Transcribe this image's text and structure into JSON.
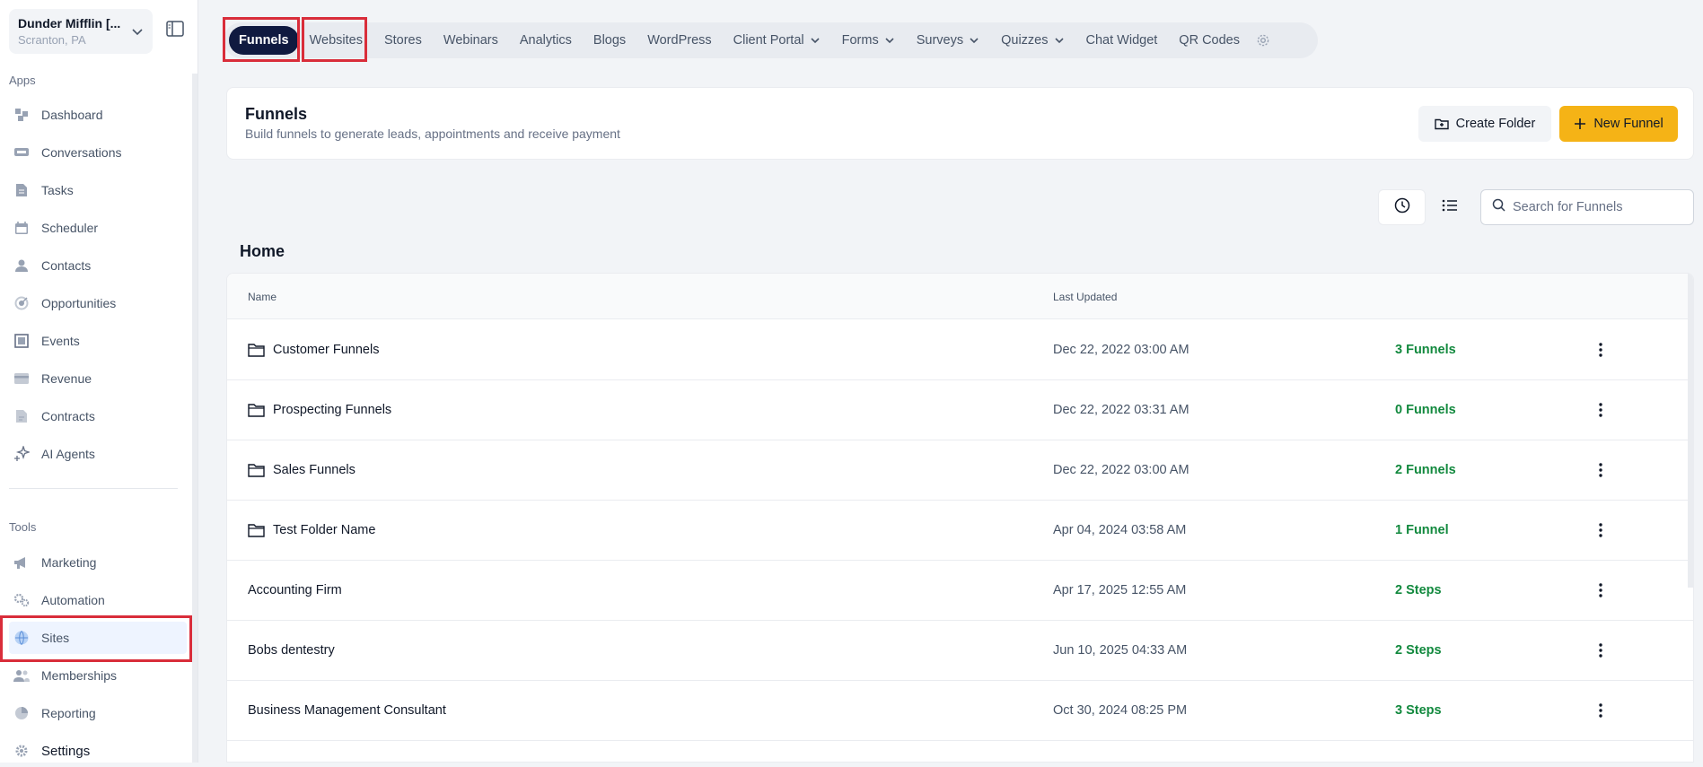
{
  "account": {
    "name": "Dunder Mifflin [...",
    "location": "Scranton, PA"
  },
  "sidebar": {
    "apps_label": "Apps",
    "apps": [
      {
        "label": "Dashboard",
        "icon": "dashboard-icon"
      },
      {
        "label": "Conversations",
        "icon": "chat-icon"
      },
      {
        "label": "Tasks",
        "icon": "document-icon"
      },
      {
        "label": "Scheduler",
        "icon": "calendar-icon"
      },
      {
        "label": "Contacts",
        "icon": "person-icon"
      },
      {
        "label": "Opportunities",
        "icon": "target-icon"
      },
      {
        "label": "Events",
        "icon": "events-icon"
      },
      {
        "label": "Revenue",
        "icon": "credit-card-icon"
      },
      {
        "label": "Contracts",
        "icon": "contract-icon"
      },
      {
        "label": "AI Agents",
        "icon": "sparkle-icon"
      }
    ],
    "tools_label": "Tools",
    "tools": [
      {
        "label": "Marketing",
        "icon": "megaphone-icon"
      },
      {
        "label": "Automation",
        "icon": "gears-icon"
      },
      {
        "label": "Sites",
        "icon": "globe-icon",
        "active": true
      },
      {
        "label": "Memberships",
        "icon": "members-icon"
      },
      {
        "label": "Reporting",
        "icon": "pie-chart-icon"
      },
      {
        "label": "Settings",
        "icon": "gear-icon"
      }
    ]
  },
  "topnav": {
    "tabs": [
      {
        "label": "Funnels",
        "active": true
      },
      {
        "label": "Websites"
      },
      {
        "label": "Stores"
      },
      {
        "label": "Webinars"
      },
      {
        "label": "Analytics"
      },
      {
        "label": "Blogs"
      },
      {
        "label": "WordPress"
      },
      {
        "label": "Client Portal",
        "dropdown": true
      },
      {
        "label": "Forms",
        "dropdown": true
      },
      {
        "label": "Surveys",
        "dropdown": true
      },
      {
        "label": "Quizzes",
        "dropdown": true
      },
      {
        "label": "Chat Widget"
      },
      {
        "label": "QR Codes"
      }
    ]
  },
  "header": {
    "title": "Funnels",
    "subtitle": "Build funnels to generate leads, appointments and receive payment",
    "create_folder_label": "Create Folder",
    "new_funnel_label": "New Funnel"
  },
  "search": {
    "placeholder": "Search for Funnels"
  },
  "home_heading": "Home",
  "table": {
    "columns": {
      "name": "Name",
      "updated": "Last Updated"
    },
    "rows": [
      {
        "name": "Customer Funnels",
        "folder": true,
        "updated": "Dec 22, 2022 03:00 AM",
        "count": "3 Funnels"
      },
      {
        "name": "Prospecting Funnels",
        "folder": true,
        "updated": "Dec 22, 2022 03:31 AM",
        "count": "0 Funnels"
      },
      {
        "name": "Sales Funnels",
        "folder": true,
        "updated": "Dec 22, 2022 03:00 AM",
        "count": "2 Funnels"
      },
      {
        "name": "Test Folder Name",
        "folder": true,
        "updated": "Apr 04, 2024 03:58 AM",
        "count": "1 Funnel"
      },
      {
        "name": "Accounting Firm",
        "folder": false,
        "updated": "Apr 17, 2025 12:55 AM",
        "count": "2 Steps"
      },
      {
        "name": "Bobs dentestry",
        "folder": false,
        "updated": "Jun 10, 2025 04:33 AM",
        "count": "2 Steps"
      },
      {
        "name": "Business Management Consultant",
        "folder": false,
        "updated": "Oct 30, 2024 08:25 PM",
        "count": "3 Steps"
      }
    ]
  },
  "colors": {
    "accent_dark": "#101a40",
    "primary_button": "#f5b316",
    "count_green": "#12893e",
    "highlight": "#d92d3a"
  }
}
